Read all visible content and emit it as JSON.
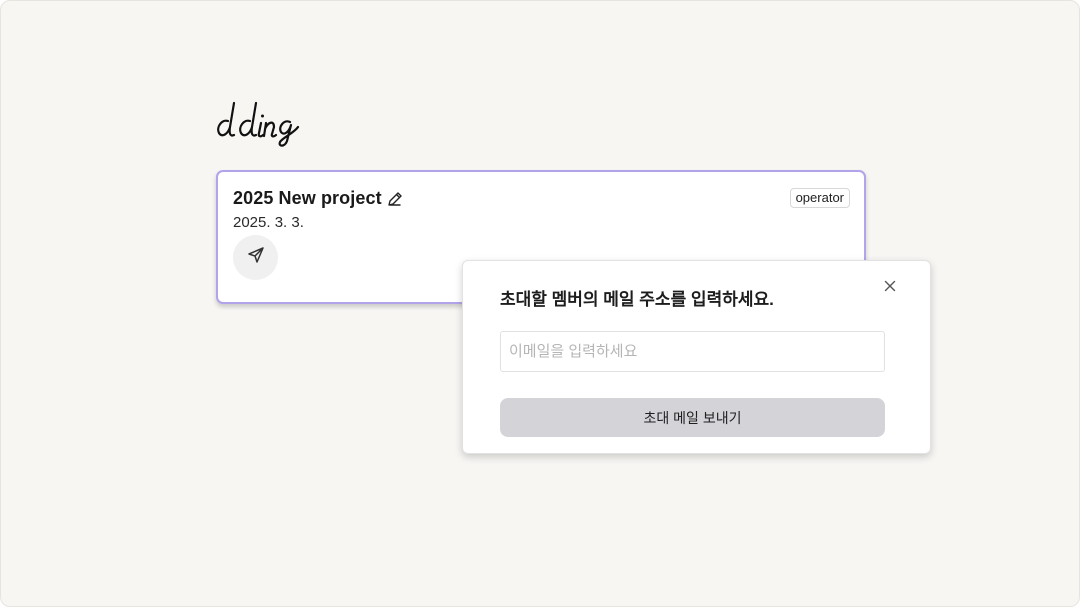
{
  "app": {
    "logo_text": "dding"
  },
  "project": {
    "title": "2025 New project",
    "date": "2025. 3. 3.",
    "role": "operator"
  },
  "invite": {
    "title": "초대할 멤버의 메일 주소를 입력하세요.",
    "email_value": "",
    "email_placeholder": "이메일을 입력하세요",
    "submit_label": "초대 메일 보내기"
  },
  "icons": {
    "edit": "pencil-icon",
    "send": "paper-plane-icon",
    "close": "close-icon"
  },
  "colors": {
    "background": "#f7f6f3",
    "card_border": "#b3a3ea",
    "button_disabled": "#d4d4d8",
    "text": "#1f1f1f"
  }
}
